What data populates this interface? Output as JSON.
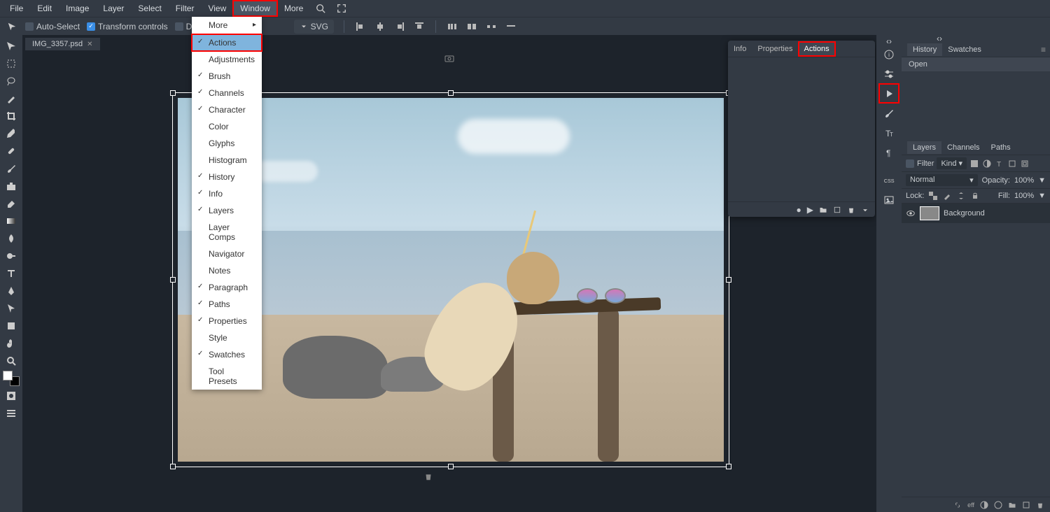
{
  "menubar": {
    "items": [
      "File",
      "Edit",
      "Image",
      "Layer",
      "Select",
      "Filter",
      "View",
      "Window",
      "More"
    ],
    "active_index": 7
  },
  "optionsbar": {
    "auto_select": {
      "label": "Auto-Select",
      "checked": false
    },
    "transform_controls": {
      "label": "Transform controls",
      "checked": true
    },
    "distances": {
      "label": "Distan",
      "checked": false
    },
    "svg_button": "SVG"
  },
  "tabs": [
    {
      "label": "IMG_3357.psd"
    }
  ],
  "window_dropdown": {
    "items": [
      {
        "label": "More",
        "submenu": true,
        "checked": false
      },
      {
        "label": "Actions",
        "checked": true,
        "highlight": true
      },
      {
        "label": "Adjustments",
        "checked": false
      },
      {
        "label": "Brush",
        "checked": true
      },
      {
        "label": "Channels",
        "checked": true
      },
      {
        "label": "Character",
        "checked": true
      },
      {
        "label": "Color",
        "checked": false
      },
      {
        "label": "Glyphs",
        "checked": false
      },
      {
        "label": "Histogram",
        "checked": false
      },
      {
        "label": "History",
        "checked": true
      },
      {
        "label": "Info",
        "checked": true
      },
      {
        "label": "Layers",
        "checked": true
      },
      {
        "label": "Layer Comps",
        "checked": false
      },
      {
        "label": "Navigator",
        "checked": false
      },
      {
        "label": "Notes",
        "checked": false
      },
      {
        "label": "Paragraph",
        "checked": true
      },
      {
        "label": "Paths",
        "checked": true
      },
      {
        "label": "Properties",
        "checked": true
      },
      {
        "label": "Style",
        "checked": false
      },
      {
        "label": "Swatches",
        "checked": true
      },
      {
        "label": "Tool Presets",
        "checked": false
      }
    ]
  },
  "info_panel": {
    "tabs": [
      "Info",
      "Properties",
      "Actions"
    ],
    "active_index": 2
  },
  "history_panel": {
    "tabs": [
      "History",
      "Swatches"
    ],
    "active_index": 0,
    "items": [
      "Open"
    ]
  },
  "layers_panel": {
    "tabs": [
      "Layers",
      "Channels",
      "Paths"
    ],
    "active_index": 0,
    "filter_label": "Filter",
    "kind": "Kind",
    "blend_mode": "Normal",
    "opacity_label": "Opacity:",
    "opacity_value": "100%",
    "lock_label": "Lock:",
    "fill_label": "Fill:",
    "fill_value": "100%",
    "layers": [
      {
        "name": "Background",
        "visible": true
      }
    ]
  },
  "colors": {
    "highlight": "#ff0000"
  }
}
